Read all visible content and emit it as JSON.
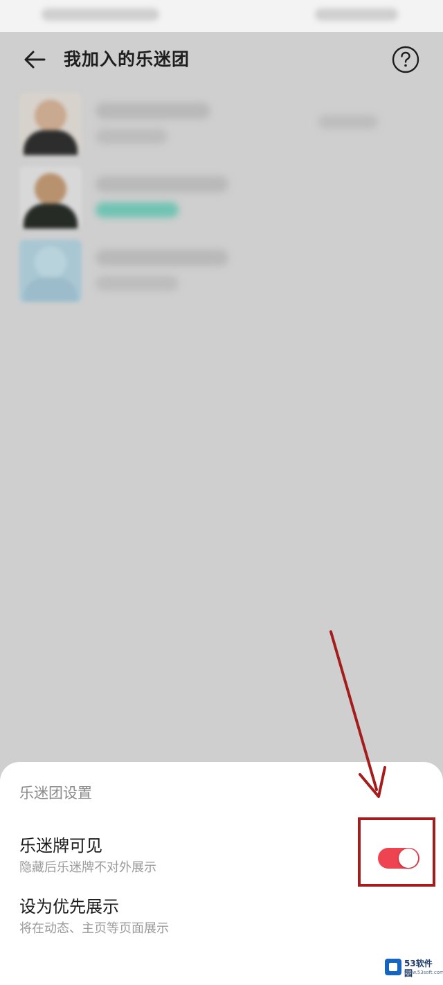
{
  "header": {
    "title": "我加入的乐迷团",
    "back_icon": "arrow-left-icon",
    "help_icon": "question-circle-icon"
  },
  "sheet": {
    "title": "乐迷团设置",
    "settings": [
      {
        "label": "乐迷牌可见",
        "description": "隐藏后乐迷牌不对外展示",
        "toggle_on": true
      },
      {
        "label": "设为优先展示",
        "description": "将在动态、主页等页面展示"
      }
    ]
  },
  "colors": {
    "toggle_on": "#ee4350",
    "annotation": "#a51c1c",
    "dim_overlay": "#cfcfcf"
  },
  "watermark": {
    "name": "53软件园",
    "url": "www.53soft.com"
  }
}
